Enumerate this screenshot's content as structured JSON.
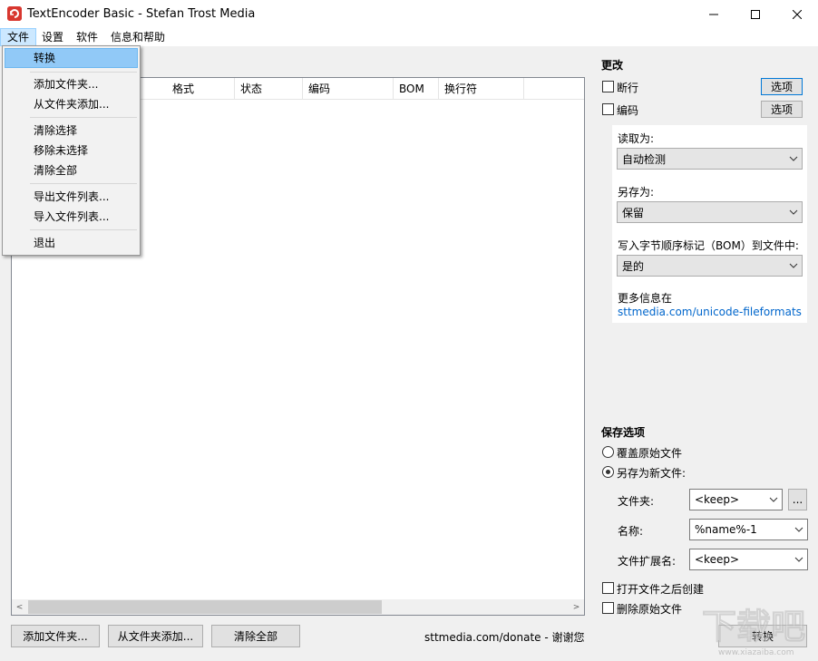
{
  "window": {
    "title": "TextEncoder Basic - Stefan Trost Media",
    "minimize_glyph": "—",
    "maximize_glyph": "☐",
    "close_glyph": "✕"
  },
  "menubar": {
    "file": "文件",
    "settings": "设置",
    "software": "软件",
    "help": "信息和帮助"
  },
  "file_menu": {
    "items": [
      "转换",
      "添加文件夹...",
      "从文件夹添加...",
      "清除选择",
      "移除未选择",
      "清除全部",
      "导出文件列表...",
      "导入文件列表...",
      "退出"
    ]
  },
  "file_list": {
    "columns": [
      "格式",
      "状态",
      "编码",
      "BOM",
      "换行符"
    ],
    "scroll_left": "<",
    "scroll_right": ">"
  },
  "bottom": {
    "add_folder": "添加文件夹...",
    "add_from_folder": "从文件夹添加...",
    "clear_all": "清除全部",
    "donate": "sttmedia.com/donate - 谢谢您",
    "convert": "转换"
  },
  "change": {
    "heading": "更改",
    "linebreak_label": "断行",
    "linebreak_checked": false,
    "encoding_label": "编码",
    "encoding_checked": false,
    "options_button": "选项",
    "options_button_2": "选项",
    "read_as_label": "读取为:",
    "read_as_value": "自动检测",
    "save_as_label": "另存为:",
    "save_as_value": "保留",
    "bom_label": "写入字节顺序标记（BOM）到文件中:",
    "bom_value": "是的",
    "more_info_label": "更多信息在",
    "more_info_link": "sttmedia.com/unicode-fileformats"
  },
  "save_options": {
    "heading": "保存选项",
    "overwrite_label": "覆盖原始文件",
    "save_new_label": "另存为新文件:",
    "selected": "save_new",
    "folder_label": "文件夹:",
    "folder_value": "<keep>",
    "browse_button": "...",
    "name_label": "名称:",
    "name_value": "%name%-1",
    "ext_label": "文件扩展名:",
    "ext_value": "<keep>",
    "open_after_label": "打开文件之后创建",
    "open_after_checked": false,
    "delete_original_label": "删除原始文件",
    "delete_original_checked": false
  },
  "watermark": {
    "text": "下载吧",
    "url": "www.xiazaiba.com"
  },
  "colors": {
    "app_icon": "#d8372f",
    "menu_highlight": "#91c9f7",
    "link": "#0066cc",
    "focus_border": "#0078d7"
  }
}
